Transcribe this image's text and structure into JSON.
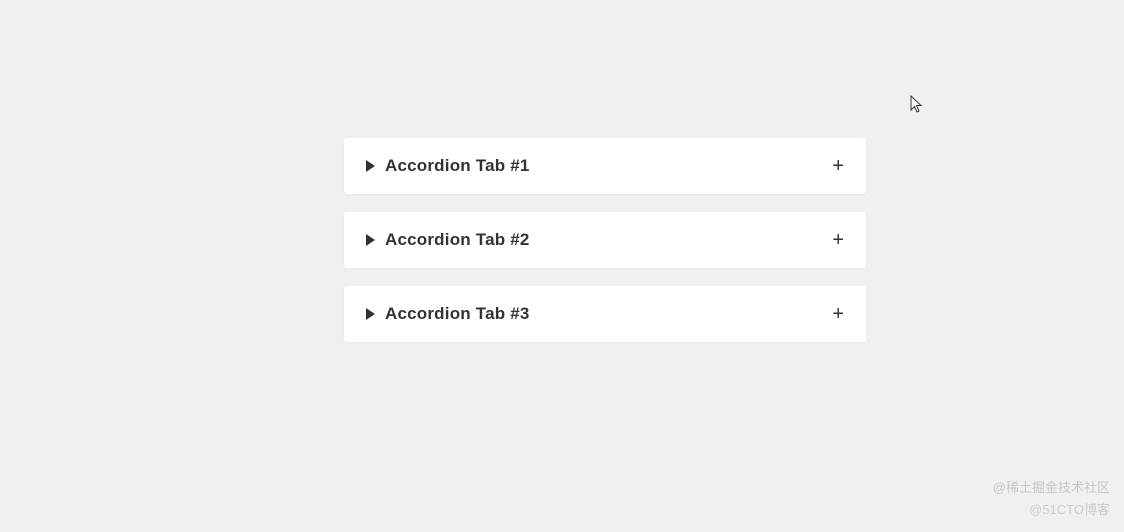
{
  "accordion": {
    "items": [
      {
        "title": "Accordion Tab #1"
      },
      {
        "title": "Accordion Tab #2"
      },
      {
        "title": "Accordion Tab #3"
      }
    ],
    "expand_symbol": "+"
  },
  "watermarks": {
    "line1": "@稀土掘金技术社区",
    "line2": "@51CTO博客"
  }
}
